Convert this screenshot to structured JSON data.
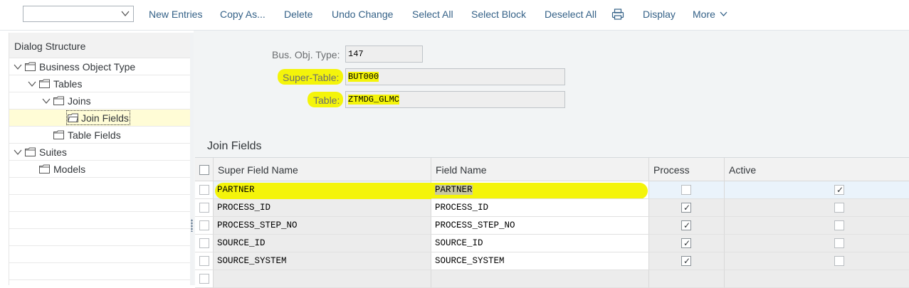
{
  "toolbar": {
    "selector_value": "",
    "buttons": [
      "New Entries",
      "Copy As...",
      "Delete",
      "Undo Change",
      "Select All",
      "Select Block",
      "Deselect All",
      "Display",
      "More"
    ],
    "print_icon": "printer-icon"
  },
  "dialog_structure": {
    "title": "Dialog Structure",
    "items": [
      {
        "label": "Business Object Type",
        "expanded": true
      },
      {
        "label": "Tables",
        "expanded": true
      },
      {
        "label": "Joins",
        "expanded": true
      },
      {
        "label": "Join Fields",
        "selected": true
      },
      {
        "label": "Table Fields"
      },
      {
        "label": "Suites",
        "expanded": true
      },
      {
        "label": "Models"
      }
    ]
  },
  "header_fields": {
    "bus_obj_type": {
      "label": "Bus. Obj. Type:",
      "value": "147"
    },
    "super_table": {
      "label": "Super-Table:",
      "value": "BUT000"
    },
    "table": {
      "label": "Table:",
      "value": "ZTMDG_GLMC"
    }
  },
  "join_fields": {
    "title": "Join Fields",
    "columns": [
      "Super Field Name",
      "Field Name",
      "Process",
      "Active"
    ],
    "rows": [
      {
        "super_field": "PARTNER",
        "field": "PARTNER",
        "process": false,
        "active": true
      },
      {
        "super_field": "PROCESS_ID",
        "field": "PROCESS_ID",
        "process": true,
        "active": false
      },
      {
        "super_field": "PROCESS_STEP_NO",
        "field": "PROCESS_STEP_NO",
        "process": true,
        "active": false
      },
      {
        "super_field": "SOURCE_ID",
        "field": "SOURCE_ID",
        "process": true,
        "active": false
      },
      {
        "super_field": "SOURCE_SYSTEM",
        "field": "SOURCE_SYSTEM",
        "process": true,
        "active": false
      },
      {
        "super_field": "",
        "field": "",
        "process": null,
        "active": null
      }
    ]
  },
  "colors": {
    "highlight": "#f4f40a",
    "link": "#346187",
    "selected_tree_row": "#fffcd6"
  }
}
